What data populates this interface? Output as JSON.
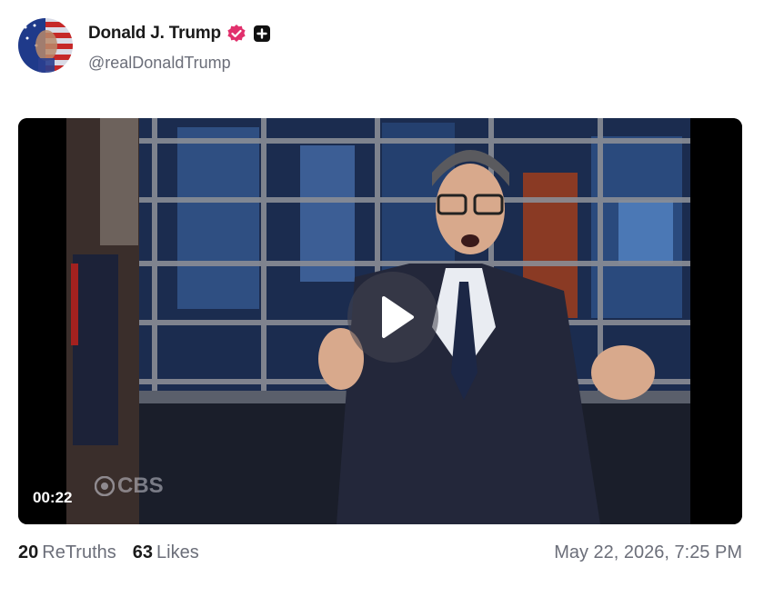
{
  "post": {
    "author": {
      "display_name": "Donald J. Trump",
      "handle": "@realDonaldTrump",
      "verified_icon": "verified-badge-icon",
      "plus_icon": "plus-square-icon"
    },
    "video": {
      "duration": "00:22",
      "watermark": "CBS",
      "play_icon": "play-icon"
    },
    "stats": {
      "retruths_count": "20",
      "retruths_label": "ReTruths",
      "likes_count": "63",
      "likes_label": "Likes"
    },
    "timestamp": "May 22, 2026, 7:25 PM"
  },
  "colors": {
    "verified": "#e1306c",
    "muted_text": "#6b6e79",
    "name_text": "#1a1a1a"
  }
}
